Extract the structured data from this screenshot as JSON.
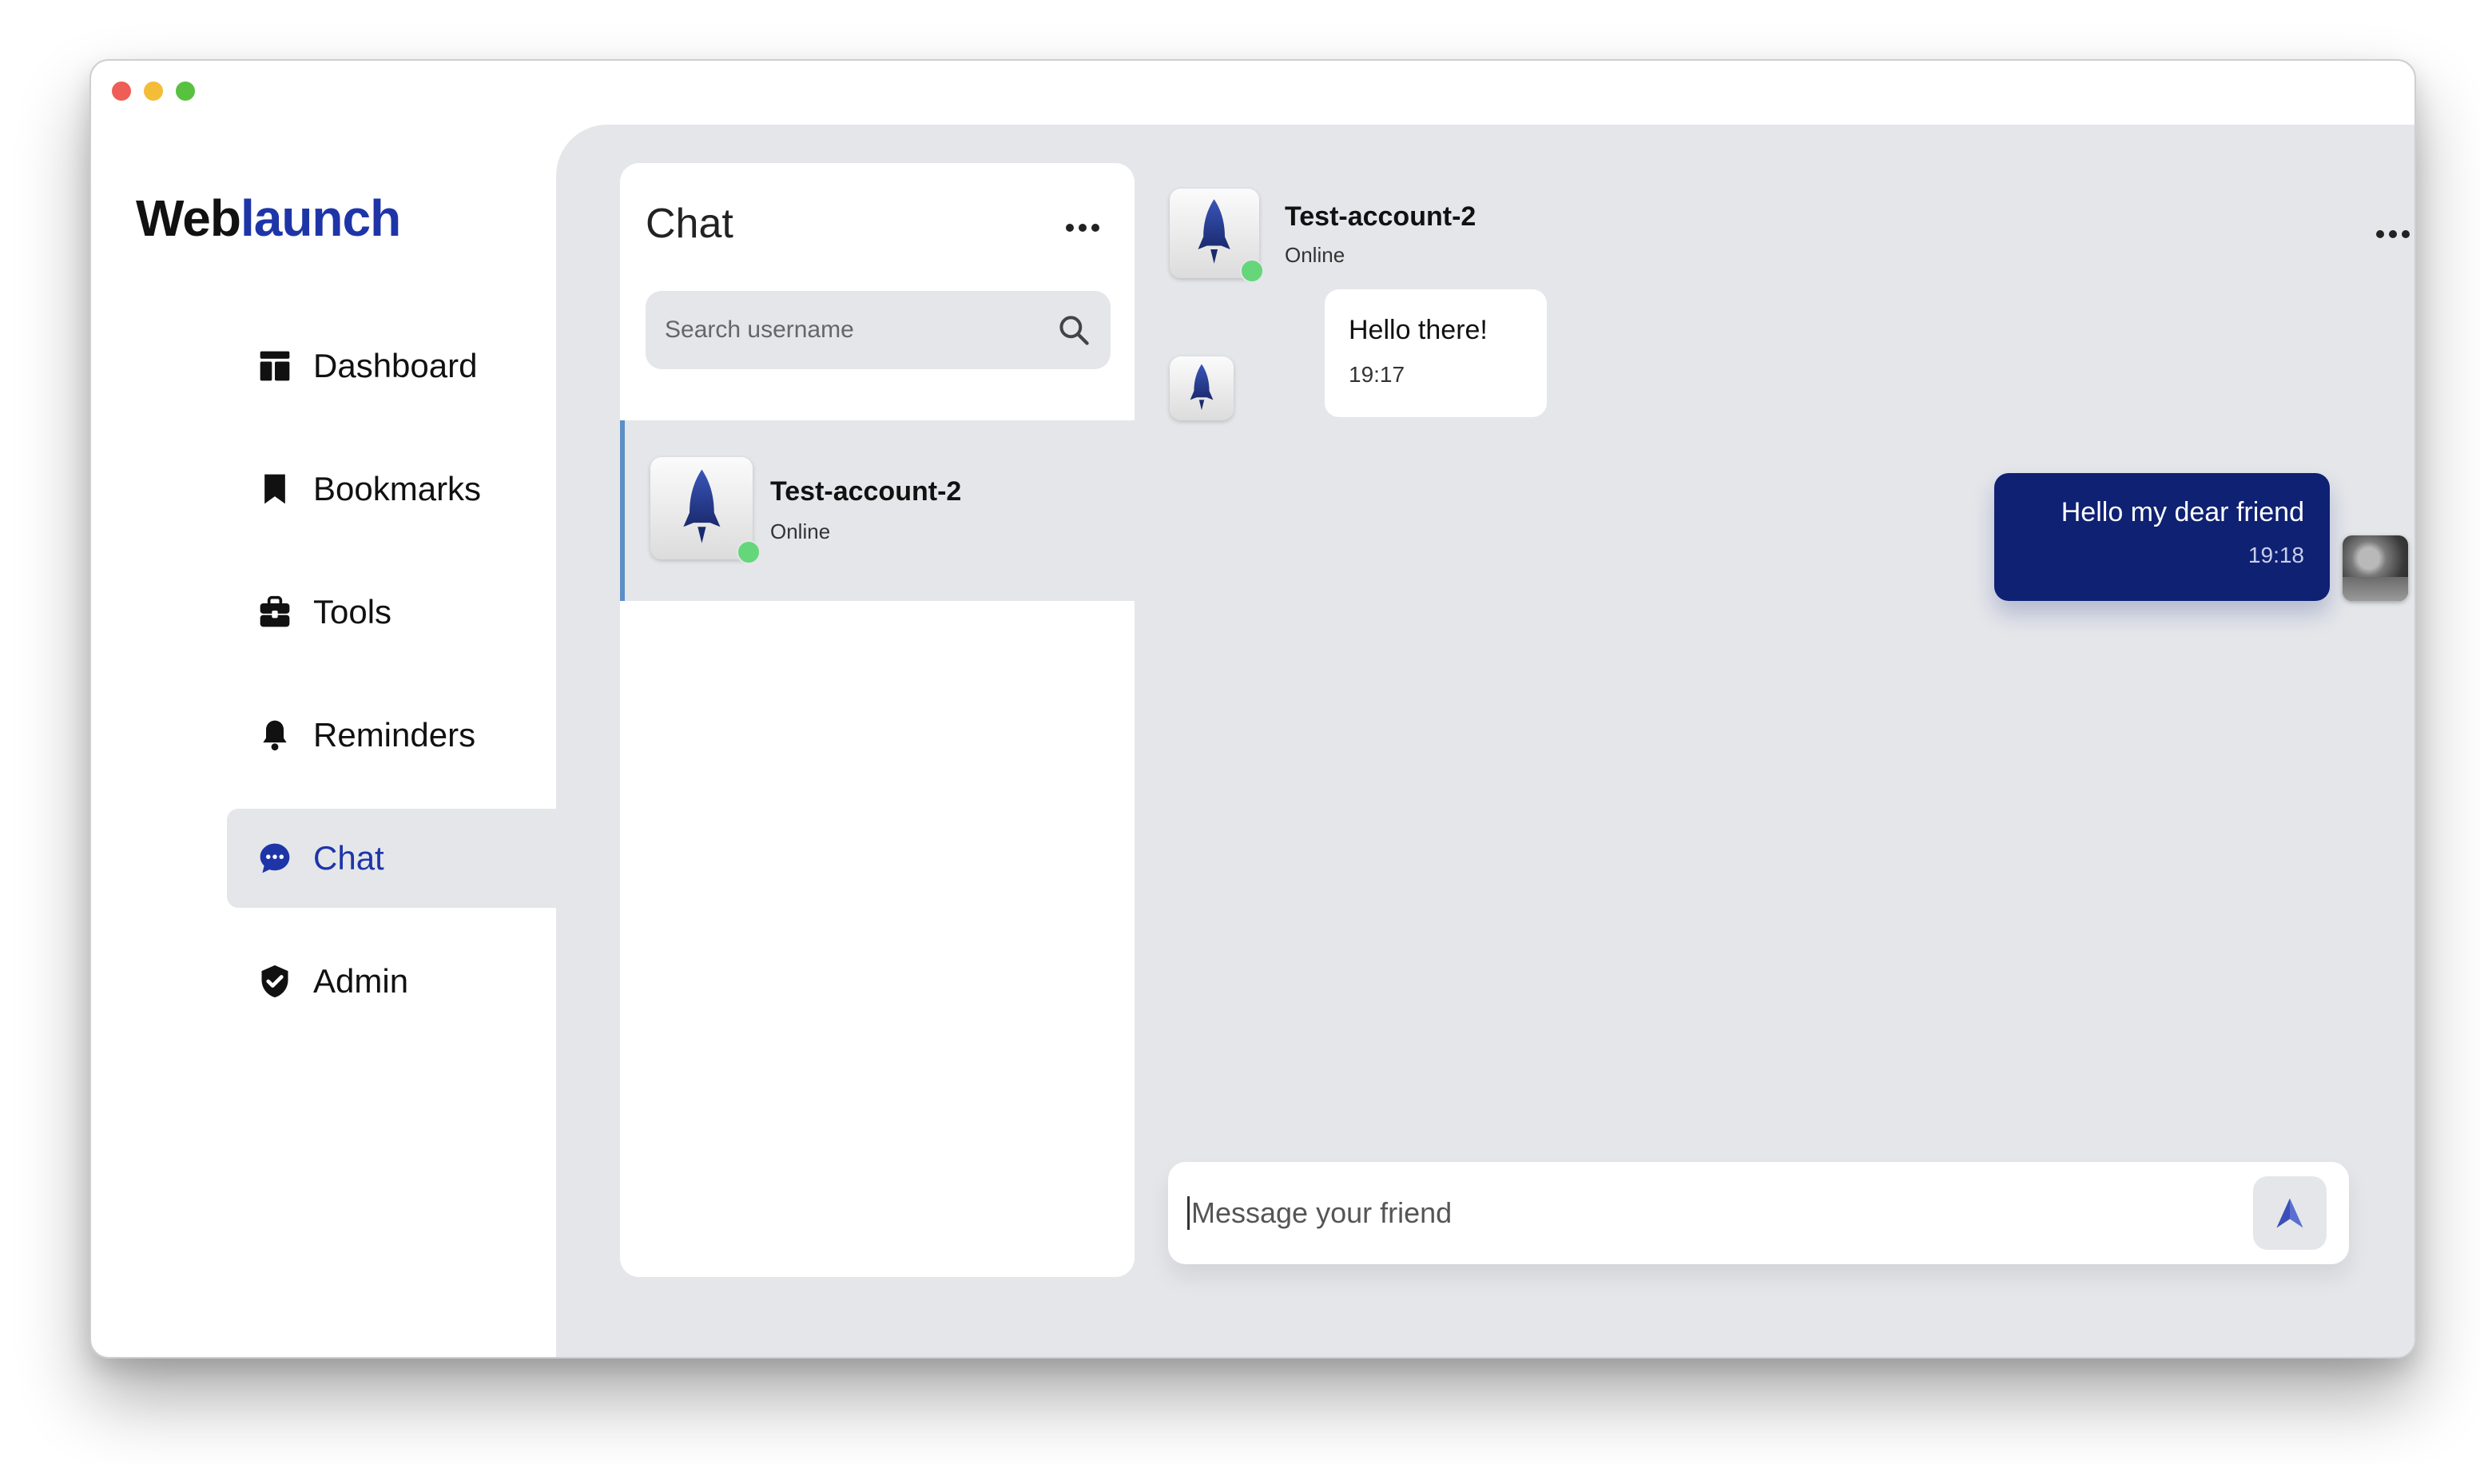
{
  "app": {
    "logo_prefix": "Web",
    "logo_accent": "launch"
  },
  "sidebar": {
    "items": [
      {
        "label": "Dashboard",
        "icon": "dashboard-icon"
      },
      {
        "label": "Bookmarks",
        "icon": "bookmark-icon"
      },
      {
        "label": "Tools",
        "icon": "toolbox-icon"
      },
      {
        "label": "Reminders",
        "icon": "bell-icon"
      },
      {
        "label": "Chat",
        "icon": "chat-bubble-icon",
        "active": true
      },
      {
        "label": "Admin",
        "icon": "shield-check-icon"
      }
    ]
  },
  "chat_list": {
    "title": "Chat",
    "search_placeholder": "Search username",
    "contacts": [
      {
        "name": "Test-account-2",
        "status": "Online"
      }
    ]
  },
  "conversation": {
    "name": "Test-account-2",
    "status": "Online",
    "messages": [
      {
        "direction": "incoming",
        "text": "Hello there!",
        "time": "19:17"
      },
      {
        "direction": "outgoing",
        "text": "Hello my dear friend",
        "time": "19:18"
      }
    ],
    "composer_placeholder": "Message your friend"
  },
  "colors": {
    "accent": "#1e35a8",
    "outgoing_bubble": "#0e2173",
    "online": "#66d67a",
    "panel_bg": "#e4e6ea"
  }
}
